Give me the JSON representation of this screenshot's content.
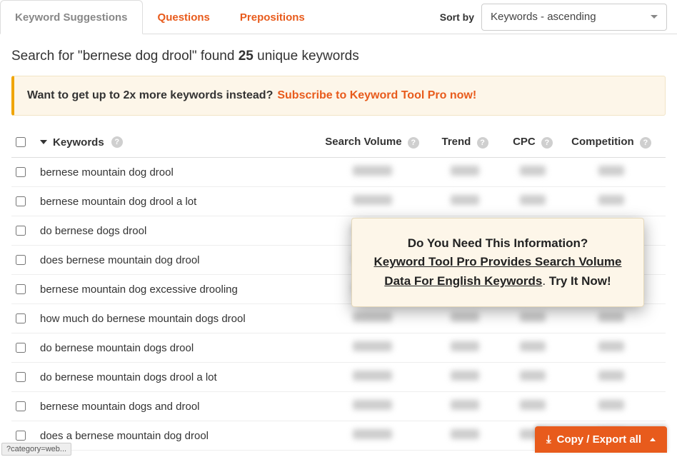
{
  "tabs": {
    "suggestions": "Keyword Suggestions",
    "questions": "Questions",
    "prepositions": "Prepositions"
  },
  "sort": {
    "label": "Sort by",
    "selected": "Keywords - ascending"
  },
  "search": {
    "prefix": "Search for \"",
    "query": "bernese dog drool",
    "mid": "\" found ",
    "count": "25",
    "suffix": " unique keywords"
  },
  "promo": {
    "lead": "Want to get up to 2x more keywords instead?",
    "link": "Subscribe to Keyword Tool Pro now!"
  },
  "columns": {
    "keywords": "Keywords",
    "search_volume": "Search Volume",
    "trend": "Trend",
    "cpc": "CPC",
    "competition": "Competition"
  },
  "rows": [
    {
      "kw": "bernese mountain dog drool"
    },
    {
      "kw": "bernese mountain dog drool a lot"
    },
    {
      "kw": "do bernese dogs drool"
    },
    {
      "kw": "does bernese mountain dog drool"
    },
    {
      "kw": "bernese mountain dog excessive drooling"
    },
    {
      "kw": "how much do bernese mountain dogs drool"
    },
    {
      "kw": "do bernese mountain dogs drool"
    },
    {
      "kw": "do bernese mountain dogs drool a lot"
    },
    {
      "kw": "bernese mountain dogs and drool"
    },
    {
      "kw": "does a bernese mountain dog drool"
    }
  ],
  "popup": {
    "q": "Do You Need This Information?",
    "link": "Keyword Tool Pro Provides Search Volume Data For English Keywords",
    "sep": ". ",
    "try": "Try It Now!"
  },
  "export": {
    "label": "Copy / Export all"
  },
  "status": "?category=web..."
}
